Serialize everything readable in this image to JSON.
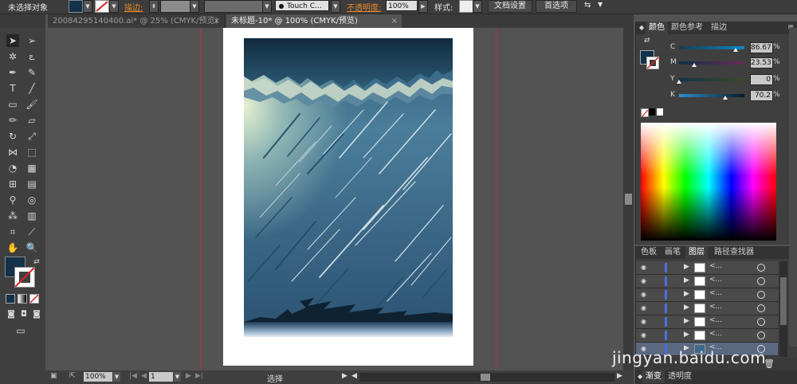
{
  "control_bar": {
    "selection_label": "未选择对象",
    "stroke_label": "描边:",
    "brush_name": "Touch C...",
    "opacity_label": "不透明度:",
    "opacity_value": "100%",
    "style_label": "样式:",
    "doc_setup_button": "文档设置",
    "preferences_button": "首选项"
  },
  "tabs": [
    {
      "label": "20084295140400.ai* @ 25% (CMYK/预览)",
      "active": false
    },
    {
      "label": "未标题-10* @ 100% (CMYK/预览)",
      "active": true
    }
  ],
  "status_bar": {
    "zoom": "100%",
    "artboard": "1",
    "tool_label": "选择"
  },
  "color_panel": {
    "tabs": [
      "颜色",
      "颜色参考",
      "描边"
    ],
    "sliders": [
      {
        "label": "C",
        "value": "86.67",
        "fraction": 0.8667
      },
      {
        "label": "M",
        "value": "23.53",
        "fraction": 0.2353
      },
      {
        "label": "Y",
        "value": "0",
        "fraction": 0
      },
      {
        "label": "K",
        "value": "70.2",
        "fraction": 0.702
      }
    ],
    "unit": "%",
    "fill_color": "#133249"
  },
  "layers_panel": {
    "tabs": [
      "色板",
      "画笔",
      "图层",
      "路径查找器"
    ],
    "rows": [
      {
        "name": "<..."
      },
      {
        "name": "<..."
      },
      {
        "name": "<..."
      },
      {
        "name": "<..."
      },
      {
        "name": "<..."
      },
      {
        "name": "<..."
      },
      {
        "name": "<..."
      }
    ],
    "footer_tabs": [
      "渐变",
      "透明度"
    ]
  },
  "watermark": "jingyan.baidu.com",
  "colors": {
    "accent_orange": "#e8892b",
    "guide_red": "#b4323b",
    "layer_blue": "#4d6fe0"
  }
}
